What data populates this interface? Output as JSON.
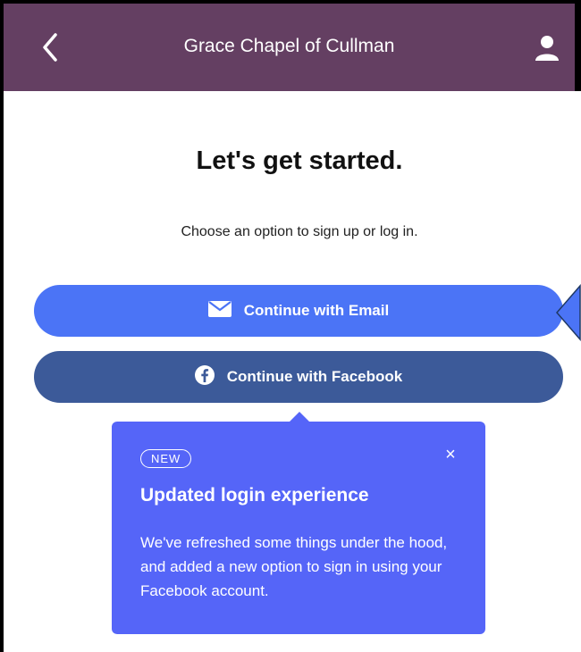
{
  "header": {
    "title": "Grace Chapel of Cullman",
    "back_icon": "chevron-left-icon",
    "user_icon": "user-icon",
    "bg_color": "#643f62"
  },
  "main": {
    "heading": "Let's get started.",
    "subtext": "Choose an option to sign up or log in."
  },
  "buttons": {
    "email": {
      "label": "Continue with Email",
      "icon": "envelope-icon",
      "color": "#4b74f6"
    },
    "facebook": {
      "label": "Continue with Facebook",
      "icon": "facebook-icon",
      "color": "#3c5a99"
    }
  },
  "popup": {
    "badge": "NEW",
    "title": "Updated login experience",
    "body": "We've refreshed some things under the hood, and added a new option to sign in using your Facebook account.",
    "close_label": "×",
    "bg_color": "#5565f8"
  }
}
